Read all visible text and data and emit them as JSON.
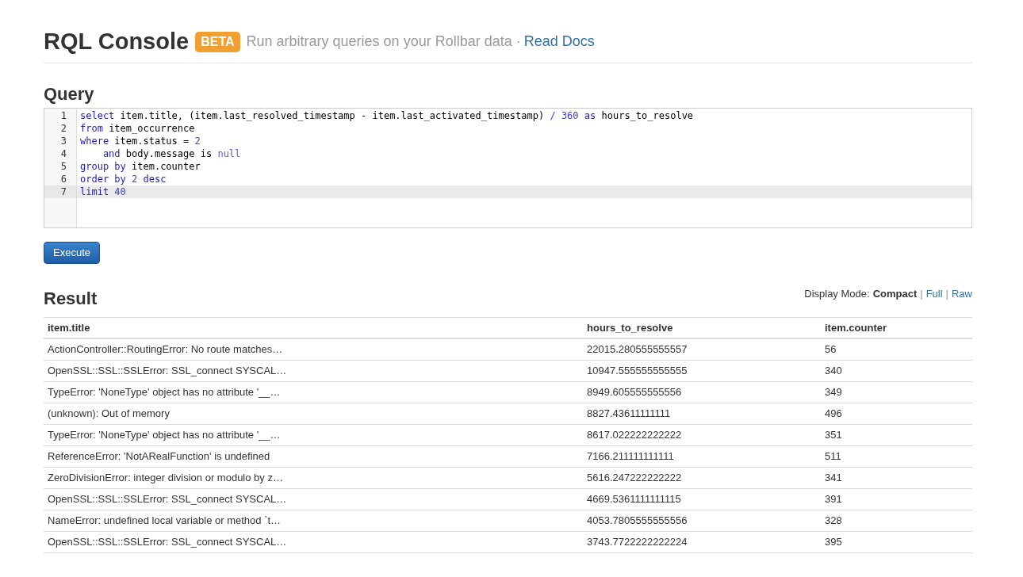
{
  "header": {
    "title": "RQL Console",
    "badge": "BETA",
    "subtitle": "Run arbitrary queries on your Rollbar data ·",
    "link": "Read Docs"
  },
  "query": {
    "heading": "Query",
    "lines": [
      {
        "number": "1",
        "active": false,
        "tokens": [
          {
            "kind": "keyword",
            "text": "select"
          },
          {
            "kind": "plain",
            "text": " item.title, (item.last_resolved_timestamp - item.last_activated_timestamp) "
          },
          {
            "kind": "operator",
            "text": "/"
          },
          {
            "kind": "number",
            "text": " 360"
          },
          {
            "kind": "keyword",
            "text": " as"
          },
          {
            "kind": "plain",
            "text": " hours_to_resolve"
          }
        ]
      },
      {
        "number": "2",
        "active": false,
        "tokens": [
          {
            "kind": "keyword",
            "text": "from"
          },
          {
            "kind": "plain",
            "text": " item_occurrence"
          }
        ]
      },
      {
        "number": "3",
        "active": false,
        "tokens": [
          {
            "kind": "keyword",
            "text": "where"
          },
          {
            "kind": "plain",
            "text": " item.status = "
          },
          {
            "kind": "number",
            "text": "2"
          }
        ]
      },
      {
        "number": "4",
        "active": false,
        "tokens": [
          {
            "kind": "keyword",
            "text": "    and"
          },
          {
            "kind": "plain",
            "text": " body.message is "
          },
          {
            "kind": "atom",
            "text": "null"
          }
        ]
      },
      {
        "number": "5",
        "active": false,
        "tokens": [
          {
            "kind": "keyword",
            "text": "group by"
          },
          {
            "kind": "plain",
            "text": " item.counter"
          }
        ]
      },
      {
        "number": "6",
        "active": false,
        "tokens": [
          {
            "kind": "keyword",
            "text": "order by"
          },
          {
            "kind": "number",
            "text": " 2"
          },
          {
            "kind": "keyword",
            "text": " desc"
          }
        ]
      },
      {
        "number": "7",
        "active": true,
        "tokens": [
          {
            "kind": "keyword",
            "text": "limit"
          },
          {
            "kind": "number",
            "text": " 40"
          }
        ]
      }
    ],
    "button": "Execute"
  },
  "result": {
    "heading": "Result",
    "display_mode_label": "Display Mode:",
    "separator": "|",
    "modes": [
      {
        "label": "Compact",
        "selected": true
      },
      {
        "label": "Full",
        "selected": false
      },
      {
        "label": "Raw",
        "selected": false
      }
    ],
    "table": {
      "columns": [
        "item.title",
        "hours_to_resolve",
        "item.counter"
      ],
      "rows": [
        [
          "ActionController::RoutingError: No route matches…",
          "22015.280555555557",
          "56"
        ],
        [
          "OpenSSL::SSL::SSLError: SSL_connect SYSCAL…",
          "10947.555555555555",
          "340"
        ],
        [
          "TypeError: 'NoneType' object has no attribute '__…",
          "8949.605555555556",
          "349"
        ],
        [
          "(unknown): Out of memory",
          "8827.43611111111",
          "496"
        ],
        [
          "TypeError: 'NoneType' object has no attribute '__…",
          "8617.022222222222",
          "351"
        ],
        [
          "ReferenceError: 'NotARealFunction' is undefined",
          "7166.211111111111",
          "511"
        ],
        [
          "ZeroDivisionError: integer division or modulo by z…",
          "5616.247222222222",
          "341"
        ],
        [
          "OpenSSL::SSL::SSLError: SSL_connect SYSCAL…",
          "4669.5361111111115",
          "391"
        ],
        [
          "NameError: undefined local variable or method `t…",
          "4053.7805555555556",
          "328"
        ],
        [
          "OpenSSL::SSL::SSLError: SSL_connect SYSCAL…",
          "3743.7722222222224",
          "395"
        ]
      ]
    }
  }
}
